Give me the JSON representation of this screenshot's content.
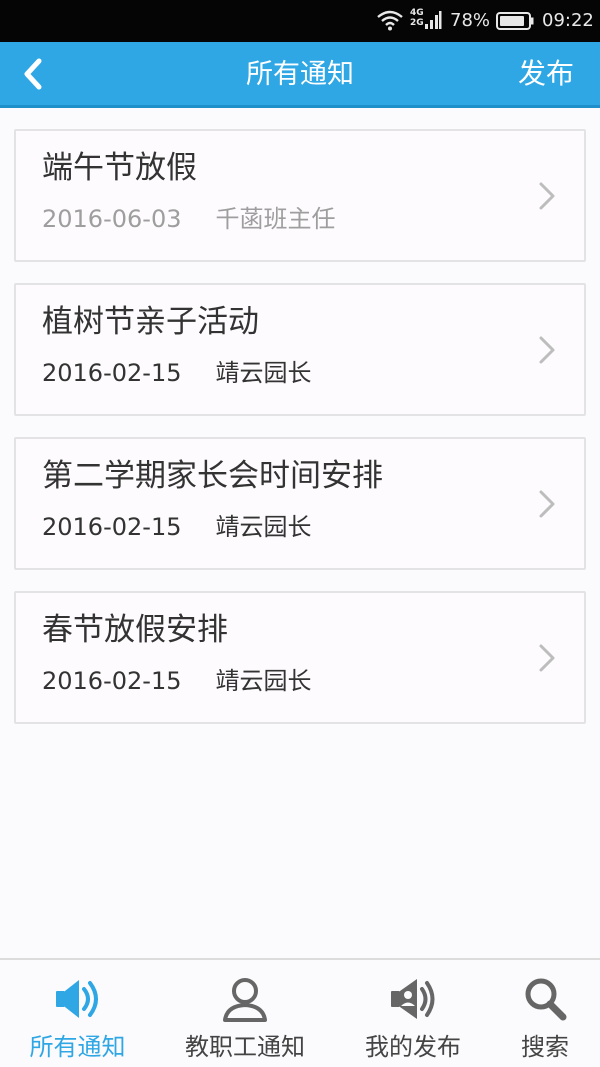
{
  "status_bar": {
    "network_top": "4G",
    "network_bottom": "2G",
    "battery_percent": "78%",
    "time": "09:22"
  },
  "header": {
    "title": "所有通知",
    "action_label": "发布"
  },
  "notices": [
    {
      "title": "端午节放假",
      "date": "2016-06-03",
      "author": "千菡班主任",
      "read": true
    },
    {
      "title": "植树节亲子活动",
      "date": "2016-02-15",
      "author": "靖云园长",
      "read": false
    },
    {
      "title": "第二学期家长会时间安排",
      "date": "2016-02-15",
      "author": "靖云园长",
      "read": false
    },
    {
      "title": "春节放假安排",
      "date": "2016-02-15",
      "author": "靖云园长",
      "read": false
    }
  ],
  "bottom_nav": {
    "tabs": [
      {
        "label": "所有通知",
        "icon": "speaker-icon",
        "active": true
      },
      {
        "label": "教职工通知",
        "icon": "person-icon",
        "active": false
      },
      {
        "label": "我的发布",
        "icon": "speaker-person-icon",
        "active": false
      },
      {
        "label": "搜索",
        "icon": "search-icon",
        "active": false
      }
    ]
  },
  "colors": {
    "accent": "#2fa7e5",
    "text": "#333333",
    "muted_text": "#9e9e9e",
    "icon_gray": "#666666"
  }
}
